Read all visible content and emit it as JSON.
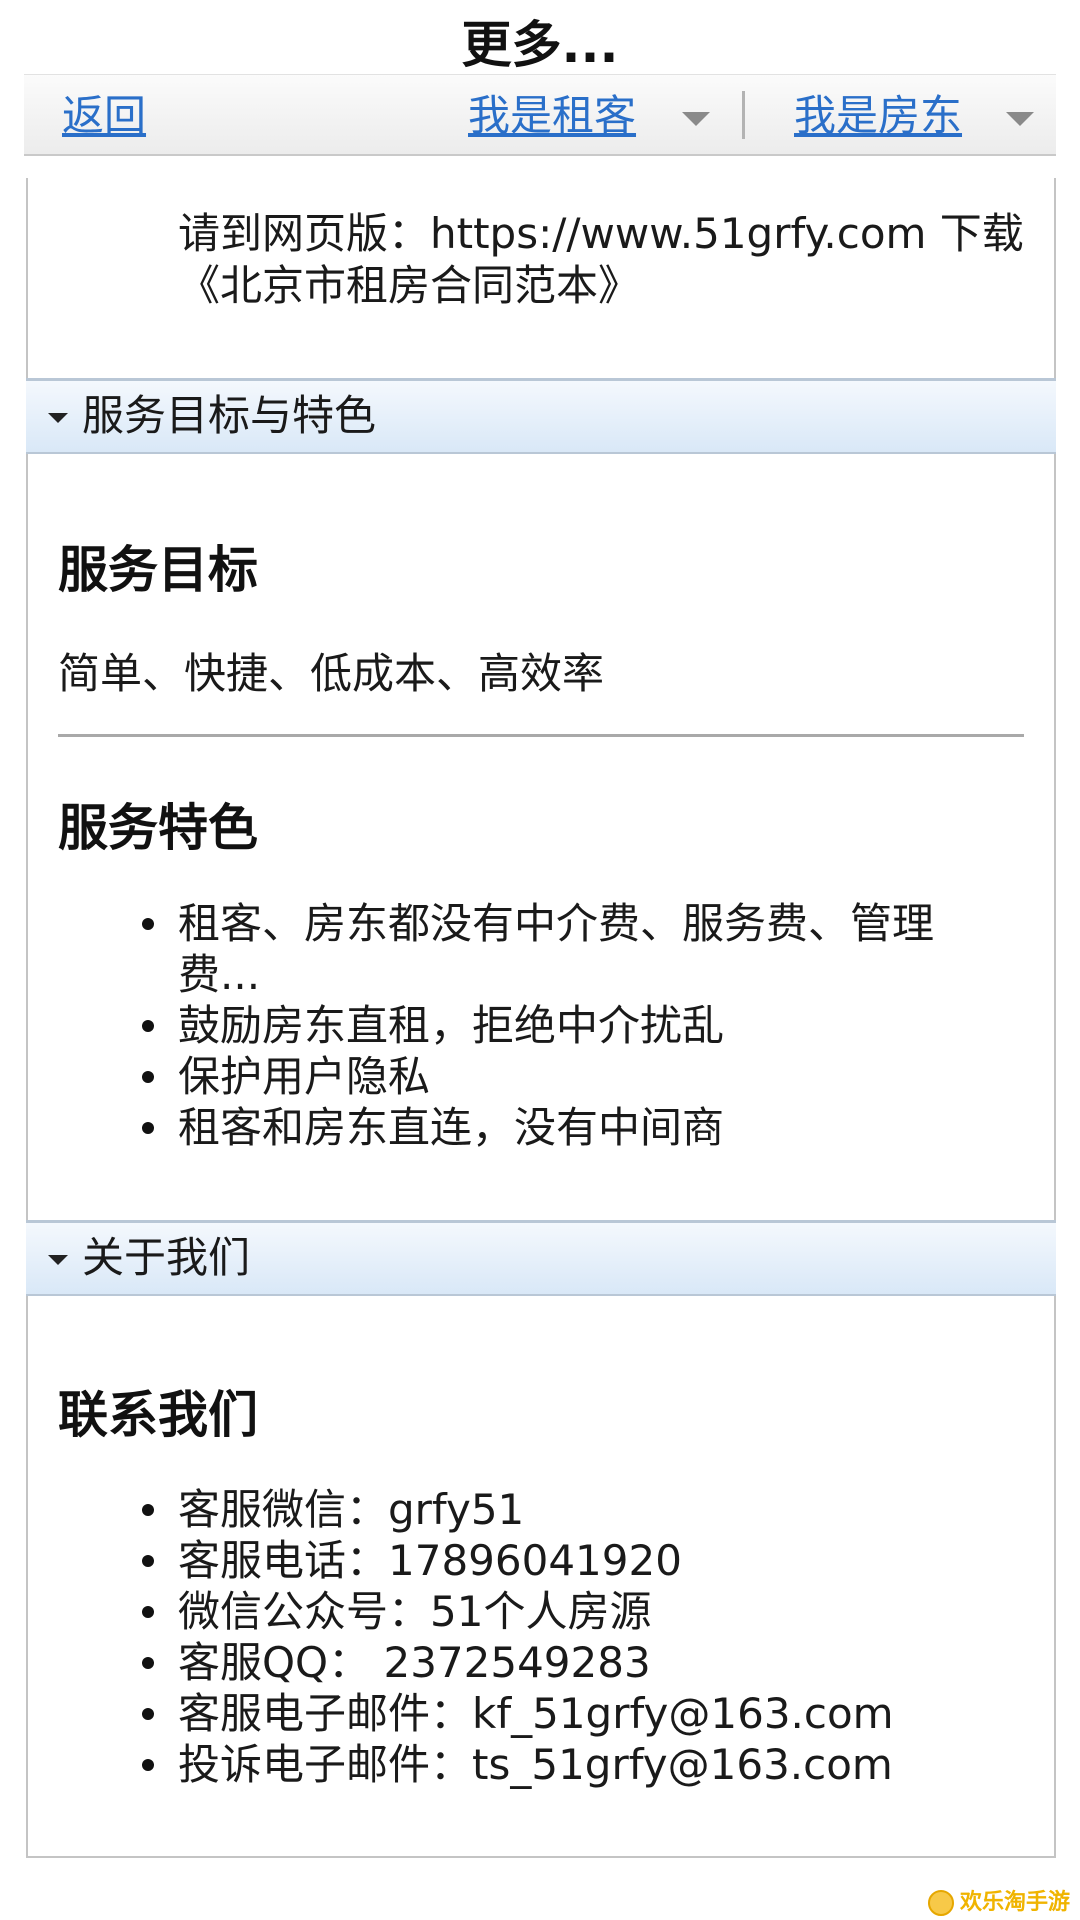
{
  "header": {
    "title": "更多..."
  },
  "toolbar": {
    "back": "返回",
    "tenant": "我是租客",
    "landlord": "我是房东"
  },
  "intro": {
    "text": "请到网页版：https://www.51grfy.com 下载《北京市租房合同范本》"
  },
  "sections": {
    "service": {
      "header": "服务目标与特色",
      "goal_title": "服务目标",
      "goal_text": "简单、快捷、低成本、高效率",
      "feature_title": "服务特色",
      "features": [
        "租客、房东都没有中介费、服务费、管理费...",
        "鼓励房东直租，拒绝中介扰乱",
        "保护用户隐私",
        "租客和房东直连，没有中间商"
      ]
    },
    "about": {
      "header": "关于我们",
      "contact_title": "联系我们",
      "contacts": [
        "客服微信：grfy51",
        "客服电话：17896041920",
        "微信公众号：51个人房源",
        "客服QQ：  2372549283",
        "客服电子邮件：kf_51grfy@163.com",
        "投诉电子邮件：ts_51grfy@163.com"
      ]
    }
  },
  "watermark": {
    "text": "欢乐淘手游"
  }
}
